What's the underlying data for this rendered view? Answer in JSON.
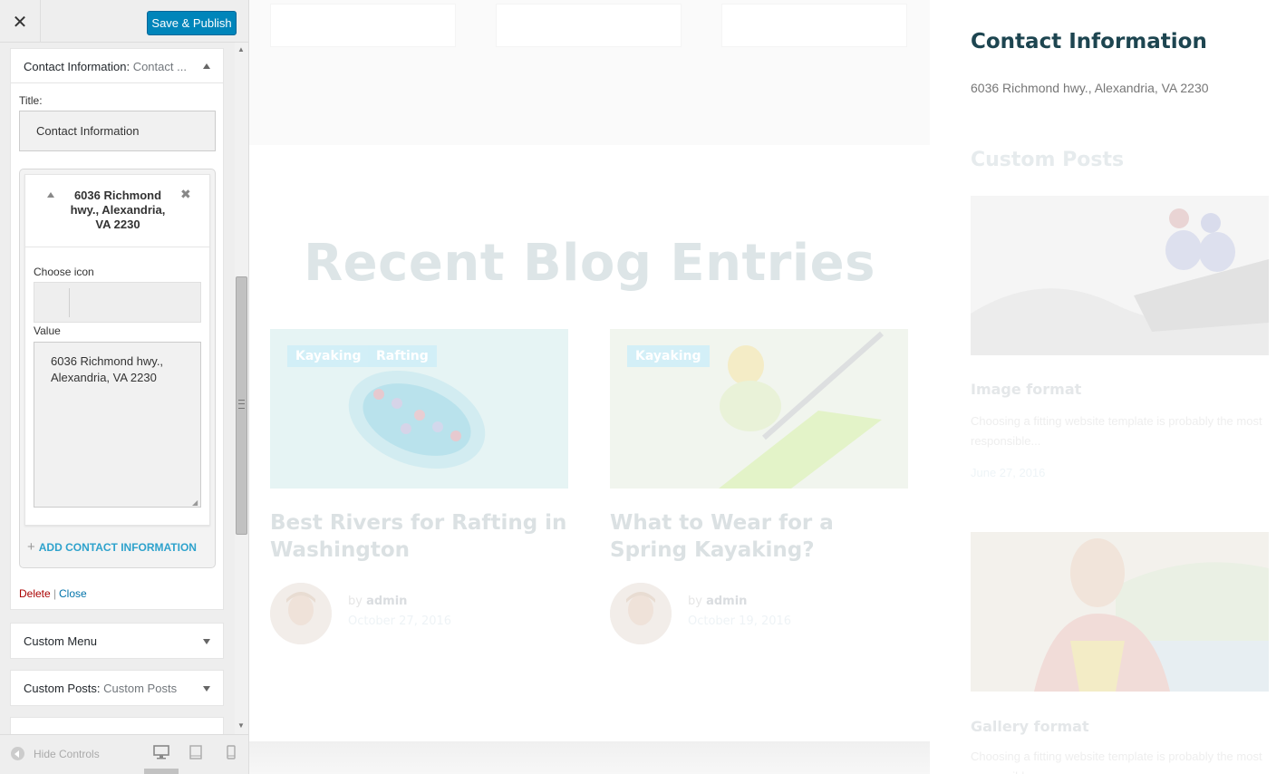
{
  "customizer": {
    "close_icon": "close-icon",
    "close_label": "✕",
    "save_label": "Save & Publish",
    "widget_contact": {
      "title_main": "Contact Information:",
      "title_sub": "Contact ...",
      "title_field_label": "Title:",
      "title_field_value": "Contact Information",
      "item": {
        "title": "6036 Richmond hwy., Alexandria, VA 2230",
        "choose_icon_label": "Choose icon",
        "value_label": "Value",
        "value_text": "6036 Richmond hwy.,\nAlexandria, VA 2230"
      },
      "add_label": "ADD CONTACT INFORMATION",
      "delete_label": "Delete",
      "separator": "|",
      "close_label": "Close"
    },
    "widgets_collapsed": [
      {
        "title_main": "Custom Menu",
        "title_sub": ""
      },
      {
        "title_main": "Custom Posts:",
        "title_sub": "Custom Posts"
      }
    ],
    "hide_controls_label": "Hide Controls",
    "colors": {
      "primary": "#0085ba",
      "link": "#0073aa",
      "delete": "#aa0000",
      "add": "#2ea2cc"
    }
  },
  "preview": {
    "blog_heading": "Recent Blog Entries",
    "posts": [
      {
        "tags": [
          "Kayaking",
          "Rafting"
        ],
        "title": "Best Rivers for Rafting in Washington",
        "by": "by",
        "author": "admin",
        "date": "October 27, 2016"
      },
      {
        "tags": [
          "Kayaking"
        ],
        "title": "What to Wear for a Spring Kayaking?",
        "by": "by",
        "author": "admin",
        "date": "October 19, 2016"
      }
    ],
    "sidebar": {
      "contact_title": "Contact Information",
      "contact_address": "6036 Richmond hwy., Alexandria, VA 2230",
      "custom_posts_title": "Custom Posts",
      "posts": [
        {
          "title": "Image format",
          "excerpt": "Choosing a fitting website template is probably the most responsible...",
          "date": "June 27, 2016"
        },
        {
          "title": "Gallery format",
          "excerpt": "Choosing a fitting website template is probably the most responsible...",
          "date": ""
        }
      ]
    },
    "colors": {
      "heading": "#1d4550"
    }
  }
}
